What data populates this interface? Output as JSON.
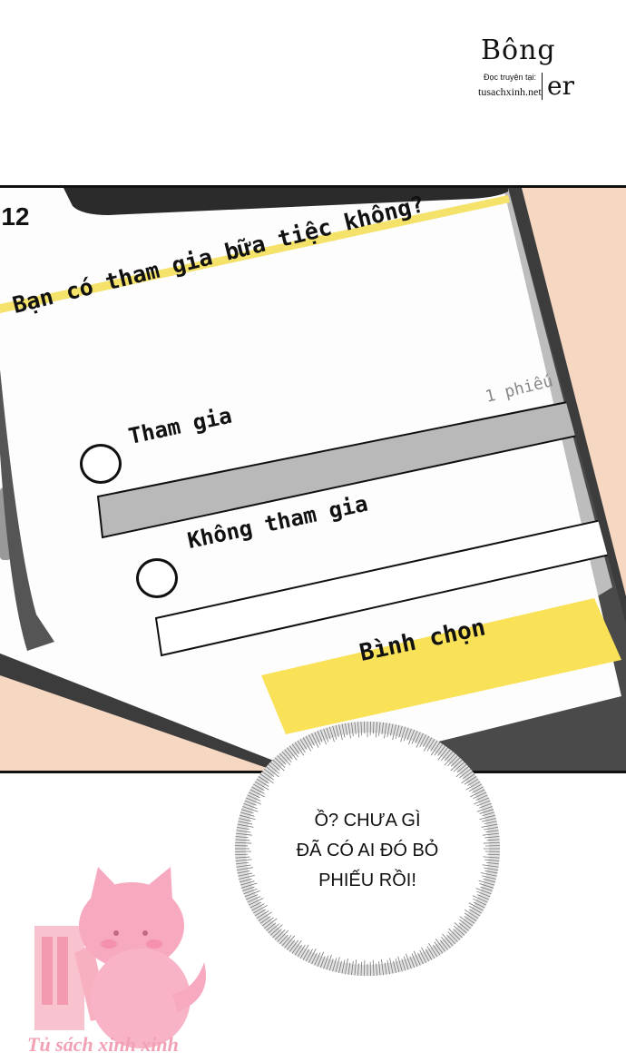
{
  "logo": {
    "name_top": "Bông",
    "name_bottom": "er",
    "read_label": "Đọc truyện tại:",
    "site": "tusachxinh.net"
  },
  "phone": {
    "time": ":12",
    "question": "Bạn có tham gia bữa tiệc không?",
    "vote_count": "1 phiếu",
    "options": [
      {
        "label": "Tham gia",
        "fill": 1.0
      },
      {
        "label": "Không tham gia",
        "fill": 0.0
      }
    ],
    "submit_label": "Bình chọn",
    "colors": {
      "accent": "#f9e158",
      "bar_fill": "#b9b9b9",
      "frame": "#3c3c3c",
      "background": "#f5d7c2"
    }
  },
  "speech": {
    "lines": [
      "Ồ? CHƯA GÌ",
      "ĐÃ CÓ AI ĐÓ BỎ",
      "PHIẾU RỒI!"
    ]
  },
  "watermark": {
    "text": "Tủ sách xinh xinh",
    "icon": "pink-cat-books-icon"
  }
}
